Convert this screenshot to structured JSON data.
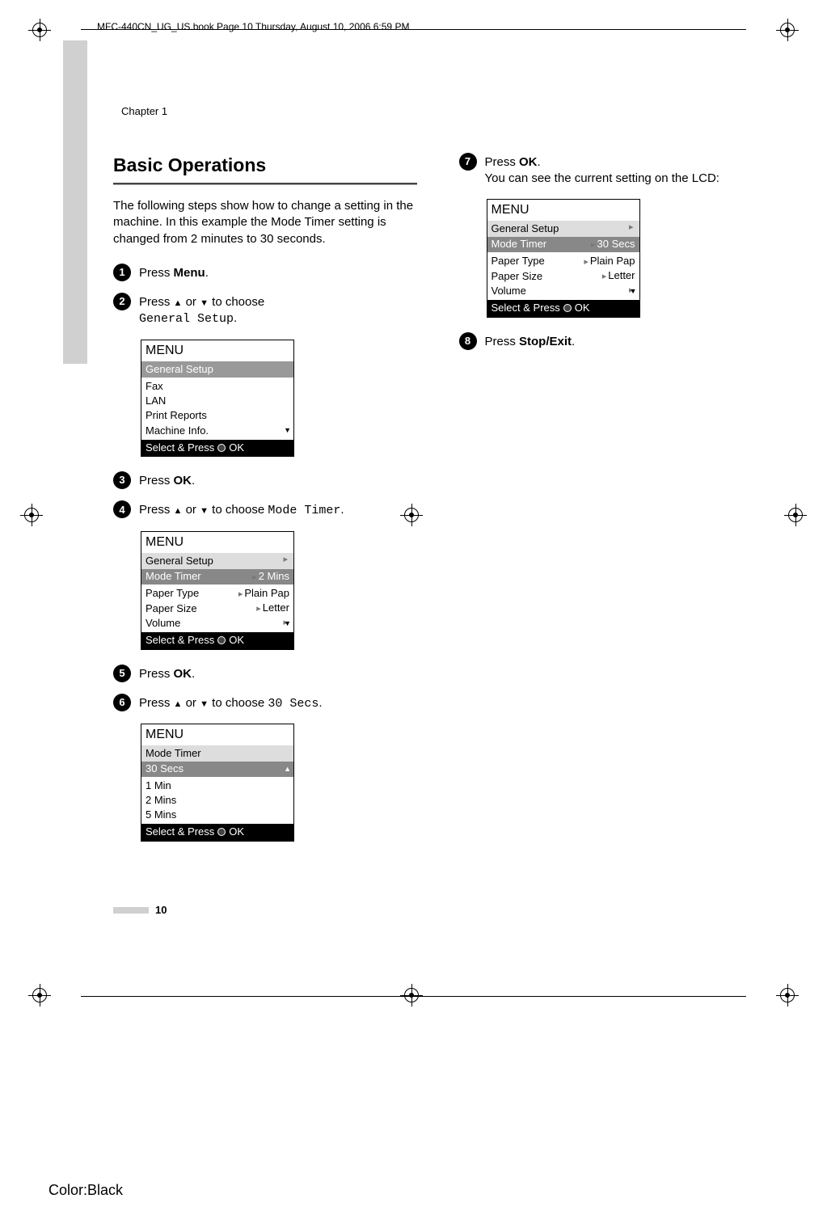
{
  "header_line": "MFC-440CN_UG_US.book  Page 10  Thursday, August 10, 2006  6:59 PM",
  "chapter": "Chapter 1",
  "title": "Basic Operations",
  "intro": "The following steps show how to change a setting in the machine. In this example the Mode Timer setting is changed from 2 minutes to 30 seconds.",
  "steps": {
    "1": {
      "num": "1",
      "pre": "Press ",
      "bold": "Menu",
      "post": "."
    },
    "2": {
      "num": "2",
      "pre": "Press ",
      "mid": " or ",
      "tail": " to choose ",
      "line2": "General Setup",
      "line2post": "."
    },
    "3": {
      "num": "3",
      "pre": "Press ",
      "bold": "OK",
      "post": "."
    },
    "4": {
      "num": "4",
      "pre": "Press ",
      "mid": " or ",
      "tail": " to choose ",
      "code": "Mode Timer",
      "codetail": "."
    },
    "5": {
      "num": "5",
      "pre": "Press ",
      "bold": "OK",
      "post": "."
    },
    "6": {
      "num": "6",
      "pre": "Press ",
      "mid": " or ",
      "tail": " to choose ",
      "code": "30 Secs",
      "codetail": "."
    },
    "7": {
      "num": "7",
      "pre": "Press ",
      "bold": "OK",
      "post": ".",
      "line2": "You can see the current setting on the LCD:"
    },
    "8": {
      "num": "8",
      "pre": "Press ",
      "bold": "Stop/Exit",
      "post": "."
    }
  },
  "lcd1": {
    "title": "MENU",
    "sub": "General Setup",
    "items": [
      "Fax",
      "LAN",
      "Print Reports",
      "Machine Info."
    ],
    "foot": "Select & Press",
    "ok": "OK"
  },
  "lcd2": {
    "title": "MENU",
    "sub": "General Setup",
    "rows": [
      {
        "label": "Mode Timer",
        "value": "2 Mins",
        "sel": true
      },
      {
        "label": "Paper Type",
        "value": "Plain Pap"
      },
      {
        "label": "Paper Size",
        "value": "Letter"
      },
      {
        "label": "Volume",
        "value": ""
      }
    ],
    "foot": "Select & Press",
    "ok": "OK"
  },
  "lcd3": {
    "title": "MENU",
    "sub": "Mode Timer",
    "rows": [
      {
        "label": "30 Secs",
        "sel": true
      },
      {
        "label": "1 Min"
      },
      {
        "label": "2 Mins"
      },
      {
        "label": "5 Mins"
      }
    ],
    "foot": "Select & Press",
    "ok": "OK"
  },
  "lcd4": {
    "title": "MENU",
    "sub": "General Setup",
    "rows": [
      {
        "label": "Mode Timer",
        "value": "30 Secs",
        "sel": true
      },
      {
        "label": "Paper Type",
        "value": "Plain Pap"
      },
      {
        "label": "Paper Size",
        "value": "Letter"
      },
      {
        "label": "Volume",
        "value": ""
      }
    ],
    "foot": "Select & Press",
    "ok": "OK"
  },
  "page_number": "10",
  "color_label": "Color:Black"
}
